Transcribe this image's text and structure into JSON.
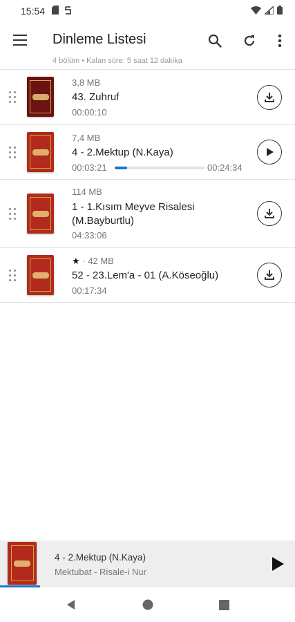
{
  "status_bar": {
    "time": "15:54",
    "icons": [
      "sd-card-icon",
      "sync-icon",
      "wifi-icon",
      "signal-icon",
      "battery-icon"
    ]
  },
  "app_bar": {
    "title": "Dinleme Listesi",
    "subtitle": "4 bölüm • Kalan süre: 5 saat 12 dakika",
    "actions": [
      "menu-icon",
      "search-icon",
      "refresh-icon",
      "more-vert-icon"
    ]
  },
  "playlist": {
    "items": [
      {
        "size": "3,8 MB",
        "title": "43. Zuhruf",
        "duration": "00:00:10",
        "action": "download-icon",
        "starred": false,
        "cover_color": "#6b1212"
      },
      {
        "size": "7,4 MB",
        "title": "4 - 2.Mektup (N.Kaya)",
        "duration": "00:03:21",
        "total": "00:24:34",
        "progress": 0.137,
        "action": "play-icon",
        "starred": false,
        "cover_color": "#b22a1c"
      },
      {
        "size": "114 MB",
        "title": "1 - 1.Kısım Meyve Risalesi (M.Bayburtlu)",
        "duration": "04:33:06",
        "action": "download-icon",
        "starred": false,
        "cover_color": "#b22a1c"
      },
      {
        "star": "★",
        "size": "· 42 MB",
        "title": "52 - 23.Lem'a - 01 (A.Köseoğlu)",
        "duration": "00:17:34",
        "action": "download-icon",
        "starred": true,
        "cover_color": "#b22a1c"
      }
    ]
  },
  "mini_player": {
    "title": "4 - 2.Mektup (N.Kaya)",
    "subtitle": "Mektubat - Risale-i Nur",
    "progress": 0.137,
    "action": "play-icon"
  },
  "nav_bar": {
    "buttons": [
      "back-icon",
      "home-icon",
      "recents-icon"
    ]
  },
  "colors": {
    "accent": "#1976d2",
    "cover_red": "#b22a1c",
    "cover_dark": "#6b1212"
  }
}
